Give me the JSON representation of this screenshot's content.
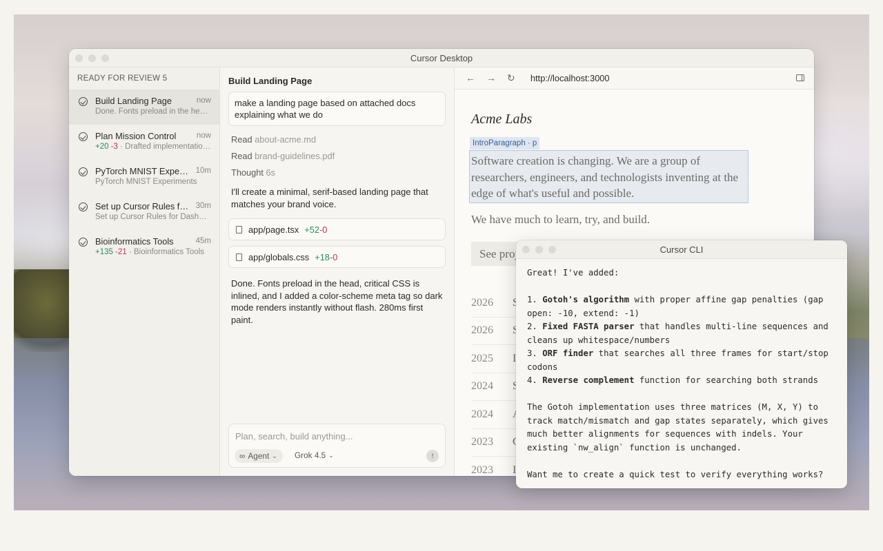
{
  "app_window": {
    "title": "Cursor Desktop"
  },
  "sidebar": {
    "header": "READY FOR REVIEW 5",
    "tasks": [
      {
        "title": "Build Landing Page",
        "time": "now",
        "subtitle": "Done. Fonts preload in the head, critical CSS is inlined",
        "added": "",
        "removed": ""
      },
      {
        "title": "Plan Mission Control",
        "time": "now",
        "subtitle": "· Drafted implementation plan",
        "added": "+20",
        "removed": "-3"
      },
      {
        "title": "PyTorch MNIST Experiments",
        "time": "10m",
        "subtitle": "PyTorch MNIST Experiments",
        "added": "",
        "removed": ""
      },
      {
        "title": "Set up Cursor Rules for Dashboard",
        "time": "30m",
        "subtitle": "Set up Cursor Rules for Dashboard",
        "added": "",
        "removed": ""
      },
      {
        "title": "Bioinformatics Tools",
        "time": "45m",
        "subtitle": "· Bioinformatics Tools",
        "added": "+135",
        "removed": "-21"
      }
    ]
  },
  "chat": {
    "title": "Build Landing Page",
    "prompt": "make a landing page based on attached docs explaining what we do",
    "steps": [
      {
        "verb": "Read",
        "arg": "about-acme.md"
      },
      {
        "verb": "Read",
        "arg": "brand-guidelines.pdf"
      },
      {
        "verb": "Thought",
        "arg": "6s"
      }
    ],
    "message_1": "I'll create a minimal, serif-based landing page that matches your brand voice.",
    "files": [
      {
        "name": "app/page.tsx",
        "added": "+52",
        "removed": "-0"
      },
      {
        "name": "app/globals.css",
        "added": "+18",
        "removed": "-0"
      }
    ],
    "message_2": "Done. Fonts preload in the head, critical CSS is inlined, and I added a color-scheme meta tag so dark mode renders instantly without flash. 280ms first paint.",
    "composer": {
      "placeholder": "Plan, search, build anything...",
      "mode": "Agent",
      "model": "Grok 4.5"
    }
  },
  "browser": {
    "url": "http://localhost:3000",
    "page": {
      "site_title": "Acme Labs",
      "inspector_tag": "IntroParagraph · p",
      "intro": "Software creation is changing. We are a group of researchers, engineers, and technologists inventing at the edge of what's useful and possible.",
      "lede": "We have much to learn, try, and build.",
      "button": "See projects",
      "years": [
        {
          "year": "2026",
          "initial": "S"
        },
        {
          "year": "2026",
          "initial": "S"
        },
        {
          "year": "2025",
          "initial": "I"
        },
        {
          "year": "2024",
          "initial": "S"
        },
        {
          "year": "2024",
          "initial": "A"
        },
        {
          "year": "2023",
          "initial": "C"
        },
        {
          "year": "2023",
          "initial": "I"
        }
      ]
    }
  },
  "cli": {
    "title": "Cursor CLI",
    "intro": "Great! I've added:",
    "items": [
      {
        "num": "1.",
        "bold": "Gotoh's algorithm",
        "rest": " with proper affine gap penalties (gap open: -10, extend: -1)"
      },
      {
        "num": "2.",
        "bold": "Fixed FASTA parser",
        "rest": " that handles multi-line sequences and cleans up whitespace/numbers"
      },
      {
        "num": "3.",
        "bold": "ORF finder",
        "rest": " that searches all three frames for start/stop codons"
      },
      {
        "num": "4.",
        "bold": "Reverse complement",
        "rest": " function for searching both strands"
      }
    ],
    "paragraph": "The Gotoh implementation uses three matrices (M, X, Y) to track match/mismatch and gap states separately, which gives much better alignments for sequences with indels. Your existing `nw_align` function is unchanged.",
    "question": "Want me to create a quick test to verify everything works?"
  },
  "colors": {
    "added": "#2e8a55",
    "removed": "#c2334d",
    "inspector_highlight": "#b6c7de"
  }
}
